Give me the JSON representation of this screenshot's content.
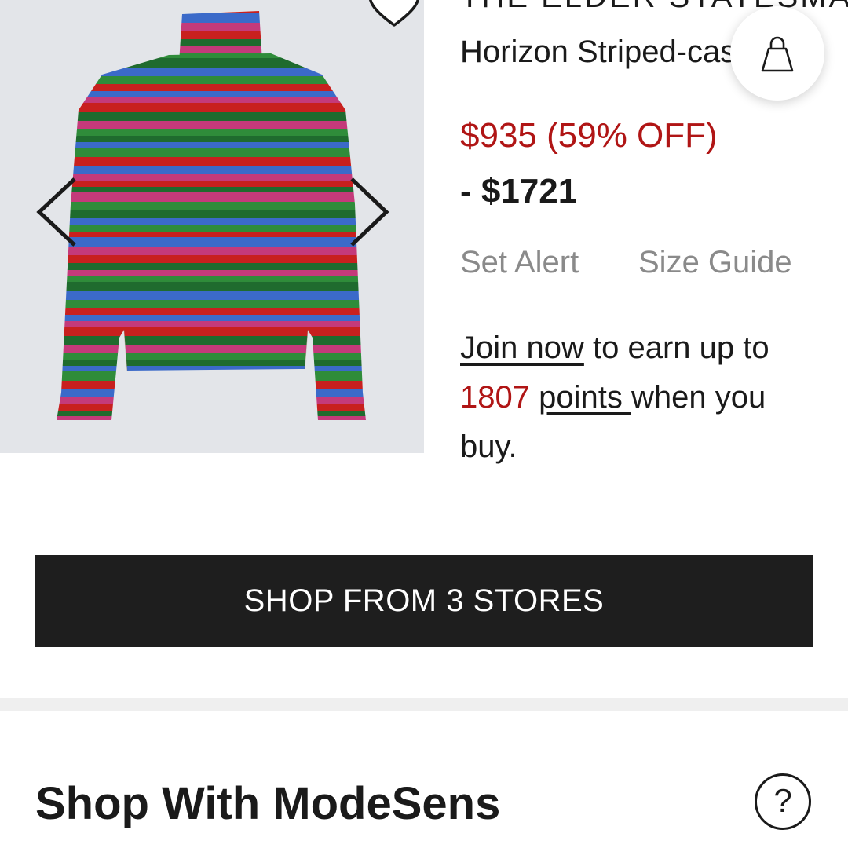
{
  "product": {
    "brand": "THE ELDER STATESMAN",
    "name": "Horizon Striped-cashmere turtleneck",
    "price_sale": "$935 (59% OFF)",
    "price_range": "- $1721",
    "stripe_colors": [
      "#c8201e",
      "#f5e81c",
      "#1f6b2e",
      "#ff8a1a",
      "#3b6ac9",
      "#e7c39a",
      "#c43a7a",
      "#f29a2e",
      "#2f8c3a",
      "#ffd21a"
    ]
  },
  "actions": {
    "set_alert": "Set Alert",
    "size_guide": "Size Guide",
    "shop_button": "SHOP FROM 3 STORES",
    "bag_icon": "shopping-bag-icon",
    "wishlist_icon": "heart-icon"
  },
  "rewards": {
    "join_link": "Join now",
    "text_1": " to earn up to ",
    "points": "1807",
    "points_link": "points ",
    "text_2": "when you buy."
  },
  "section": {
    "title": "Shop With ModeSens",
    "help_label": "?"
  },
  "colors": {
    "sale_red": "#b01515",
    "button_dark": "#1e1e1e",
    "muted_text": "#8a8a8a"
  }
}
